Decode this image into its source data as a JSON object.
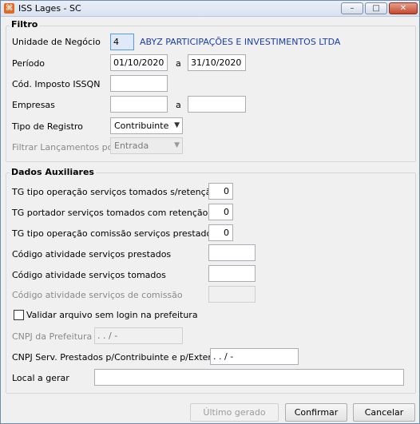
{
  "window": {
    "icon_glyph": "⌘",
    "title": "ISS Lages - SC",
    "minimize": "–",
    "maximize": "□",
    "close": "✕"
  },
  "filtro": {
    "legend": "Filtro",
    "unidade_label": "Unidade de Negócio",
    "unidade_value": "4",
    "unidade_name": "ABYZ PARTICIPAÇÕES E INVESTIMENTOS LTDA",
    "periodo_label": "Período",
    "periodo_start": "01/10/2020",
    "periodo_sep": "a",
    "periodo_end": "31/10/2020",
    "cod_imposto_label": "Cód. Imposto ISSQN",
    "cod_imposto_value": "",
    "empresas_label": "Empresas",
    "empresas_start": "",
    "empresas_sep": "a",
    "empresas_end": "",
    "tipo_registro_label": "Tipo de Registro",
    "tipo_registro_value": "Contribuinte",
    "filtrar_label": "Filtrar Lançamentos por",
    "filtrar_value": "Entrada"
  },
  "auxiliares": {
    "legend": "Dados Auxiliares",
    "tg_tomados_sret_label": "TG tipo operação serviços tomados s/retenção",
    "tg_tomados_sret_value": "0",
    "tg_portador_label": "TG portador serviços tomados com retenção",
    "tg_portador_value": "0",
    "tg_comissao_label": "TG tipo operação comissão serviços prestados",
    "tg_comissao_value": "0",
    "cod_prestados_label": "Código atividade serviços prestados",
    "cod_prestados_value": "",
    "cod_tomados_label": "Código atividade serviços tomados",
    "cod_tomados_value": "",
    "cod_comissao_label": "Código atividade serviços de comissão",
    "cod_comissao_value": "",
    "validar_label": "Validar arquivo sem login na prefeitura",
    "validar_checked": false,
    "cnpj_prefeitura_label": "CNPJ da Prefeitura",
    "cnpj_prefeitura_value": "  .   .   /    -",
    "cnpj_serv_label": "CNPJ Serv. Prestados p/Contribuinte e p/Exterior",
    "cnpj_serv_value": "  .   .   /    -",
    "local_label": "Local a gerar",
    "local_value": ""
  },
  "footer": {
    "ultimo_label": "Último gerado",
    "confirmar_label": "Confirmar",
    "cancelar_label": "Cancelar"
  }
}
